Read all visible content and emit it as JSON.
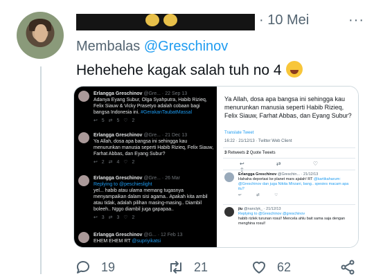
{
  "header": {
    "date_sep": "· 10 Mei",
    "menu": "···"
  },
  "reply": {
    "prefix": "Membalas",
    "handle": "@Greschinov"
  },
  "tweet": {
    "text": "Hehehehe kagak salah tuh no 4"
  },
  "media_left": {
    "tweets": [
      {
        "name": "Erlangga Greschinov",
        "handle": "@Gre...",
        "date": "22 Sep 13",
        "body": "Adanya Eyang Subur, Olga Syahputra, Habib Rizieq, Felix Siauw & Vicky Prasetyo adalah cobaan bagi bangsa Indonesia ini.",
        "link": "#GerakanTaubatMassal",
        "actions": "↩ 5  ⇄ 5  ♡ 2"
      },
      {
        "name": "Erlangga Greschinov",
        "handle": "@Gre...",
        "date": "21 Dec 13",
        "body": "Ya Allah, dosa apa bangsa ini sehingga kau menurunkan manusia seperti Habib Rizieq, Felix Siauw, Farhat Abbas, dan Eyang Subur?",
        "link": "",
        "actions": "↩ 2  ⇄ 4  ♡ 2"
      },
      {
        "name": "Erlangga Greschinov",
        "handle": "@Gre...",
        "date": "26 Mar",
        "body": "yel... habib atau ulama memang tugasnya menyampaikan dalam sisi agama.. Apakah kita ambil atau tidak, adalah pilihan masing-masing.. Diambil boleeh.. Nggo diambil juga gapapaa..",
        "link": "Replying to @peschieslight",
        "actions": "↩ 3  ⇄ 3  ♡ 2"
      },
      {
        "name": "Erlangga Greschinov",
        "handle": "@G...",
        "date": "12 Feb 13",
        "body": "EHEM EHEM RT",
        "link": "@supriyikatsi",
        "actions": ""
      }
    ]
  },
  "media_right": {
    "main_text": "Ya Allah, dosa apa bangsa ini sehingga kau menurunkan manusia seperti Habib Rizieq, Felix Siauw, Farhat Abbas, dan Eyang Subur?",
    "translate": "Translate Tweet",
    "timestamp": "16:22 · 21/12/13 · Twitter Web Client",
    "retweets": "3",
    "retweets_label": "Retweets",
    "quotes": "2",
    "quotes_label": "Quote Tweets",
    "icons": "↩ ⇄ ♡ ⇪",
    "replies": [
      {
        "name": "Erlangga Greschinov",
        "handle": "@Greschin...",
        "date": "21/12/13",
        "body": "Hahaha deportasi ke planet mars ajalah! RT",
        "link": "@kartikaharum: @Greschinov dan juga Nikita Mirzani, bang.. spesies macam apa itu?",
        "actions": "↩ ⇄ ♡"
      },
      {
        "name": "jiu",
        "handle": "@nanclyk_",
        "date": "21/12/13",
        "body": "habib rizlek turunan rosul! Mencela ahlu bait sama saja dengan menghina rosul!",
        "link": "Replying to @Greschinov  @greschinov",
        "actions": ""
      }
    ]
  },
  "actions": {
    "replies": "19",
    "retweets": "21",
    "likes": "62"
  },
  "colors": {
    "link": "#1d9bf0",
    "muted": "#536471",
    "text": "#0f1419"
  }
}
